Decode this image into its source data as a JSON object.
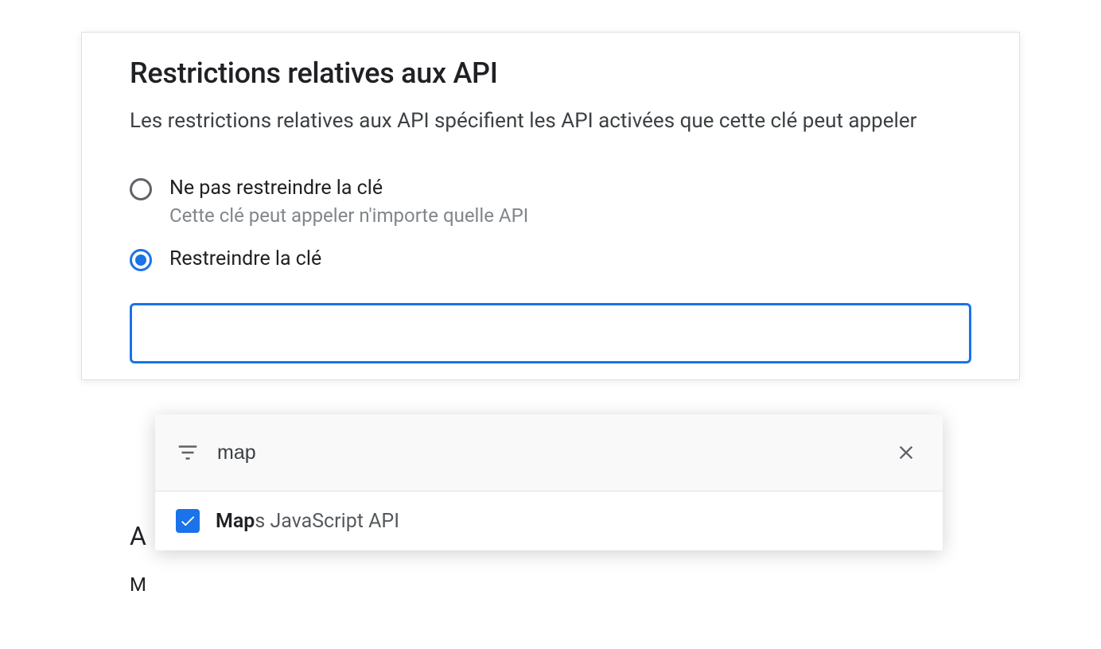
{
  "section": {
    "title": "Restrictions relatives aux API",
    "description": "Les restrictions relatives aux API spécifient les API activées que cette clé peut appeler"
  },
  "radios": {
    "noRestrict": {
      "label": "Ne pas restreindre la clé",
      "sub": "Cette clé peut appeler n'importe quelle API"
    },
    "restrict": {
      "label": "Restreindre la clé"
    }
  },
  "dropdown": {
    "query": "map",
    "result_highlight": "Map",
    "result_rest": "s JavaScript API"
  },
  "obscured": {
    "line1": "A",
    "line2": "M"
  }
}
